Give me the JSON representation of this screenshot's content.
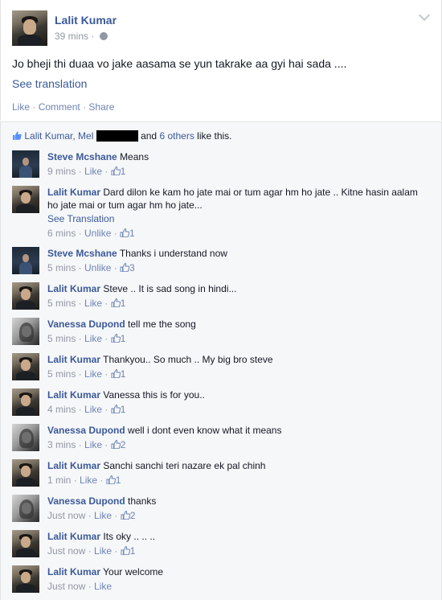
{
  "post": {
    "author": "Lalit Kumar",
    "time": "39 mins",
    "middot": "·",
    "text": "Jo bheji thi duaa vo jake aasama se yun takrake aa gyi hai sada ....",
    "see_translation": "See translation",
    "actions": {
      "like": "Like",
      "comment": "Comment",
      "share": "Share",
      "sep": "·"
    }
  },
  "likes": {
    "names": "Lalit Kumar, Mel",
    "and": "and",
    "others": "6 others",
    "suffix": "like this."
  },
  "comments": [
    {
      "author": "Steve Mcshane",
      "avatar": "steve",
      "text": "Means",
      "time": "9 mins",
      "action": "Like",
      "count": "1"
    },
    {
      "author": "Lalit Kumar",
      "avatar": "lalit",
      "text": "Dard dilon ke kam ho jate mai or tum agar hm ho jate .. Kitne hasin aalam ho jate mai or tum agar hm ho jate...",
      "see_translation": "See Translation",
      "time": "6 mins",
      "action": "Unlike",
      "count": "1"
    },
    {
      "author": "Steve Mcshane",
      "avatar": "steve",
      "text": "Thanks i understand now",
      "time": "5 mins",
      "action": "Unlike",
      "count": "3"
    },
    {
      "author": "Lalit Kumar",
      "avatar": "lalit",
      "text": "Steve .. It is sad song in hindi...",
      "time": "5 mins",
      "action": "Like",
      "count": "1"
    },
    {
      "author": "Vanessa Dupond",
      "avatar": "vanessa",
      "text": "tell me the song",
      "time": "5 mins",
      "action": "Like",
      "count": "1"
    },
    {
      "author": "Lalit Kumar",
      "avatar": "lalit",
      "text": "Thankyou.. So much .. My big bro steve",
      "time": "5 mins",
      "action": "Like",
      "count": "1"
    },
    {
      "author": "Lalit Kumar",
      "avatar": "lalit",
      "text": "Vanessa this is for you..",
      "time": "4 mins",
      "action": "Like",
      "count": "1"
    },
    {
      "author": "Vanessa Dupond",
      "avatar": "vanessa",
      "text": "well i dont even know what it means",
      "time": "3 mins",
      "action": "Like",
      "count": "2"
    },
    {
      "author": "Lalit Kumar",
      "avatar": "lalit",
      "text": "Sanchi sanchi teri nazare ek pal chinh",
      "time": "1 min",
      "action": "Like",
      "count": "1"
    },
    {
      "author": "Vanessa Dupond",
      "avatar": "vanessa",
      "text": "thanks",
      "time": "Just now",
      "action": "Like",
      "count": "2"
    },
    {
      "author": "Lalit Kumar",
      "avatar": "lalit",
      "text": "Its oky .. .. ..",
      "time": "Just now",
      "action": "Like",
      "count": "1"
    },
    {
      "author": "Lalit Kumar",
      "avatar": "lalit",
      "text": "Your welcome",
      "time": "Just now",
      "action": "Like",
      "count": null
    }
  ],
  "icons": {
    "chevron": "chevron-down-icon",
    "globe": "globe-icon",
    "thumb": "thumbs-up-icon"
  },
  "colors": {
    "link": "#3b5998",
    "meta": "#9197a3",
    "panel": "#f6f7f9"
  }
}
